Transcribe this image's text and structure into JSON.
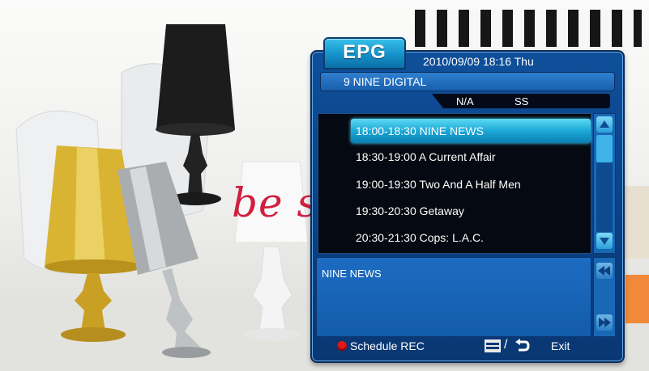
{
  "epg": {
    "tab_label": "EPG",
    "datetime": "2010/09/09 18:16 Thu",
    "channel": "9 NINE DIGITAL",
    "info": {
      "rating": "N/A",
      "audio": "SS"
    },
    "programs": [
      {
        "label": "18:00-18:30 NINE NEWS",
        "selected": true
      },
      {
        "label": "18:30-19:00 A Current Affair",
        "selected": false
      },
      {
        "label": "19:00-19:30 Two And A Half Men",
        "selected": false
      },
      {
        "label": "19:30-20:30 Getaway",
        "selected": false
      },
      {
        "label": "20:30-21:30 Cops: L.A.C.",
        "selected": false
      }
    ],
    "description": "NINE NEWS",
    "footer": {
      "schedule_label": "Schedule REC",
      "exit_label": "Exit"
    }
  },
  "background": {
    "script_text": "be st"
  },
  "colors": {
    "panel": "#0b3f80",
    "highlight": "#1ca8d6",
    "rec": "#e01a1a"
  },
  "icons": [
    "red-record-dot-icon",
    "guide-list-icon",
    "back-arrow-icon",
    "scroll-up-icon",
    "scroll-down-icon",
    "page-up-icon",
    "page-down-icon"
  ]
}
